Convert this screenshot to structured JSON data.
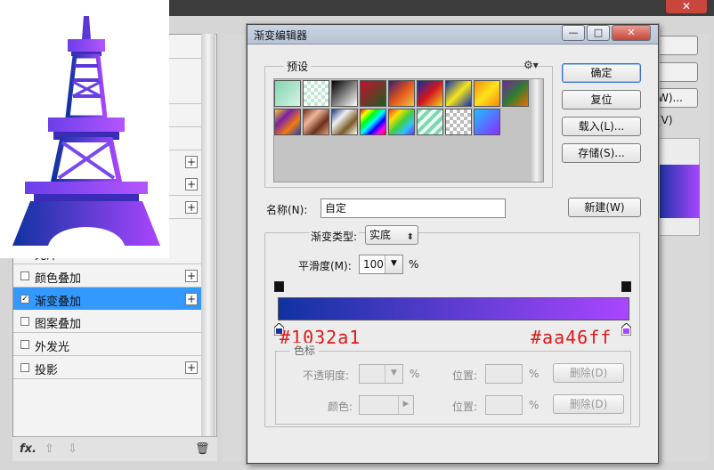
{
  "colors": {
    "start": "#1032a1",
    "end": "#aa46ff",
    "annotation": "#e01818",
    "selection": "#3399ff"
  },
  "background_window": {
    "close_icon": "close-icon",
    "side_items": [
      {
        "label": "",
        "checked": false,
        "plus": false
      },
      {
        "label": "",
        "checked": false,
        "plus": false
      },
      {
        "label": "",
        "checked": false,
        "plus": false
      },
      {
        "label": "",
        "checked": false,
        "plus": false
      },
      {
        "label": "",
        "checked": false,
        "plus": false
      },
      {
        "label": "",
        "checked": false,
        "plus": true
      },
      {
        "label": "",
        "checked": false,
        "plus": true
      },
      {
        "label": "",
        "checked": false,
        "plus": true
      },
      {
        "label": "",
        "checked": false,
        "plus": false
      },
      {
        "label": "光泽",
        "checked": false,
        "plus": false
      },
      {
        "label": "颜色叠加",
        "checked": false,
        "plus": true
      },
      {
        "label": "渐变叠加",
        "checked": true,
        "plus": true
      },
      {
        "label": "图案叠加",
        "checked": false,
        "plus": false
      },
      {
        "label": "外发光",
        "checked": false,
        "plus": false
      },
      {
        "label": "投影",
        "checked": false,
        "plus": true
      }
    ],
    "bottom_bar": {
      "fx": "fx.",
      "up": "⇧",
      "down": "⇩",
      "trash": "🗑"
    },
    "right_button_partial": "W)...",
    "right_label_partial": "(V)"
  },
  "dialog": {
    "title": "渐变编辑器",
    "window_buttons": {
      "minimize": "—",
      "maximize": "□",
      "close": "✕"
    },
    "presets_label": "预设",
    "buttons": {
      "ok": "确定",
      "reset": "复位",
      "load": "载入(L)...",
      "save": "存储(S)...",
      "new": "新建(W)"
    },
    "name_label": "名称(N):",
    "name_value": "自定",
    "gradient_type_label": "渐变类型:",
    "gradient_type_value": "实底",
    "smoothness_label": "平滑度(M):",
    "smoothness_value": "100",
    "smoothness_unit": "%",
    "start_hex": "#1032a1",
    "end_hex": "#aa46ff",
    "color_stops_title": "色标",
    "opacity_label": "不透明度:",
    "opacity_unit": "%",
    "location_label": "位置:",
    "location_unit": "%",
    "delete_label": "删除(D)",
    "color_label": "颜色:",
    "presets": [
      {
        "name": "foreground-to-background",
        "css": "linear-gradient(135deg,#7fd6b0,#d9f2e6)"
      },
      {
        "name": "foreground-to-transparent",
        "css": "repeating-conic-gradient(#bfe9d3 0 25%, #ffffff 0 50%) 0 0/8px 8px"
      },
      {
        "name": "black-white",
        "css": "linear-gradient(135deg,#000,#fff)"
      },
      {
        "name": "red-green",
        "css": "linear-gradient(135deg,#c8102e,#1b5e20)"
      },
      {
        "name": "violet-orange",
        "css": "linear-gradient(135deg,#3b1a7a,#e0541a,#f6c343)"
      },
      {
        "name": "blue-red-yellow",
        "css": "linear-gradient(135deg,#0b2fa8,#d0151e,#f7d11b)"
      },
      {
        "name": "blue-yellow-blue",
        "css": "linear-gradient(135deg,#0d2fb0,#f5e51a,#0d2fb0)"
      },
      {
        "name": "orange-yellow-orange",
        "css": "linear-gradient(135deg,#f28a10,#ffe21a,#f28a10)"
      },
      {
        "name": "violet-green-orange",
        "css": "linear-gradient(135deg,#7b1fa2,#2e7d32,#ef6c00)"
      },
      {
        "name": "yellow-violet-orange-blue",
        "css": "linear-gradient(135deg,#f8d21b,#7a1fa8,#f07b10,#1f3fb8)"
      },
      {
        "name": "copper",
        "css": "linear-gradient(135deg,#6a2f1c,#f2b79a,#6a2f1c,#e8a080)"
      },
      {
        "name": "chrome",
        "css": "linear-gradient(135deg,#1a3b7a,#f0f0f0,#7a5a28,#ffffff)"
      },
      {
        "name": "spectrum",
        "css": "linear-gradient(135deg,#ff0000,#ffff00,#00ff00,#00ffff,#0000ff,#ff00ff,#ff0000)"
      },
      {
        "name": "transparent-rainbow",
        "css": "linear-gradient(135deg,#ff3030,#ffe000,#40d040,#30c0ff,#6a30ff)"
      },
      {
        "name": "transparent-stripes",
        "css": "repeating-linear-gradient(135deg,#7fd6b0 0 4px,#e6fff2 4px 8px)"
      },
      {
        "name": "transparent-checker",
        "css": "repeating-conic-gradient(#bcbcbc 0 25%, #ffffff 0 50%) 0 0/8px 8px"
      },
      {
        "name": "blue-violet",
        "css": "linear-gradient(135deg,#1fc0ff,#8a2bff)"
      }
    ]
  }
}
